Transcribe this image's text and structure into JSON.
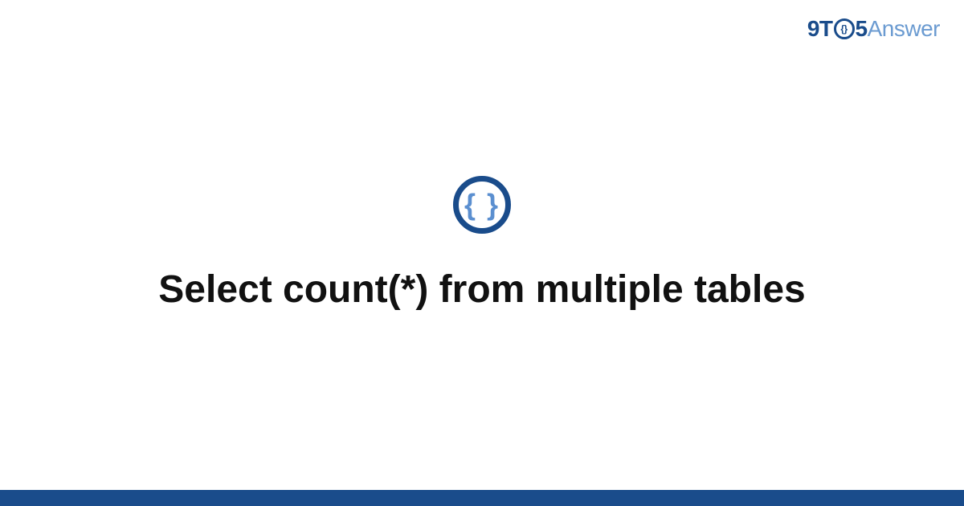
{
  "header": {
    "logo_prefix": "9T",
    "logo_clock_inner": "{}",
    "logo_five": "5",
    "logo_suffix": "Answer"
  },
  "main": {
    "icon_braces": "{ }",
    "title": "Select count(*) from multiple tables"
  }
}
